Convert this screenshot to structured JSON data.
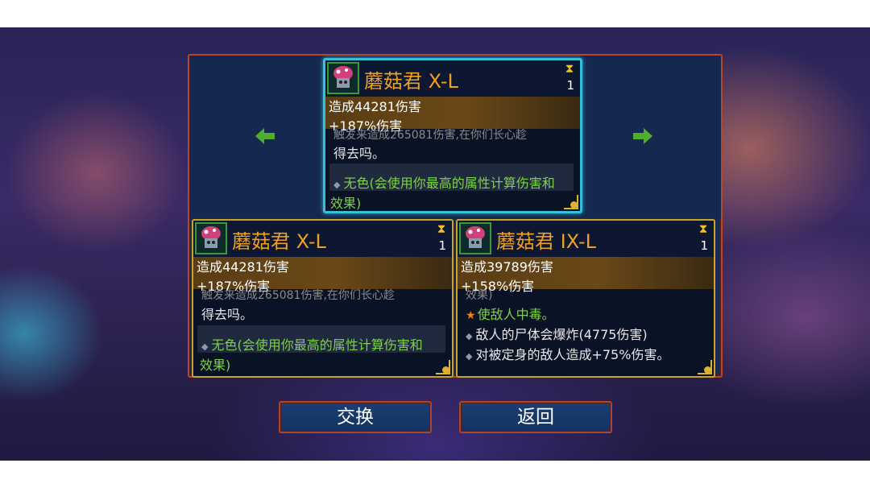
{
  "cards": [
    {
      "name": "蘑菇君 X-L",
      "count": "1",
      "stat1": "造成44281伤害",
      "stat2": "+187%伤害",
      "partial_line": "触发来造成265081伤害,在你们长心趁",
      "line1": "得去吗。",
      "color_line": "无色(会使用你最高的属性计算伤害和",
      "color_line2": "效果)"
    },
    {
      "name": "蘑菇君 X-L",
      "count": "1",
      "stat1": "造成44281伤害",
      "stat2": "+187%伤害",
      "partial_line": "触发来造成265081伤害,在你们长心趁",
      "line1": "得去吗。",
      "color_line": "无色(会使用你最高的属性计算伤害和",
      "color_line2": "效果)"
    },
    {
      "name": "蘑菇君 IX-L",
      "count": "1",
      "stat1": "造成39789伤害",
      "stat2": "+158%伤害",
      "partial_line": "效果)",
      "poison_line": "使敌人中毒。",
      "explode_line": "敌人的尸体会爆炸(4775伤害)",
      "fixed_line": "对被定身的敌人造成+75%伤害。"
    }
  ],
  "buttons": {
    "swap": "交换",
    "back": "返回"
  },
  "icons": {
    "left_arrow": "arrow-left",
    "right_arrow": "arrow-right",
    "hourglass": "hourglass",
    "avatar": "mushroom-monster"
  },
  "colors": {
    "selected_border": "#35c0d8",
    "card_border": "#c9a227",
    "name": "#f0a020",
    "green_text": "#7fd04a",
    "arrow": "#4fae2f",
    "button_border": "#b0442a"
  }
}
